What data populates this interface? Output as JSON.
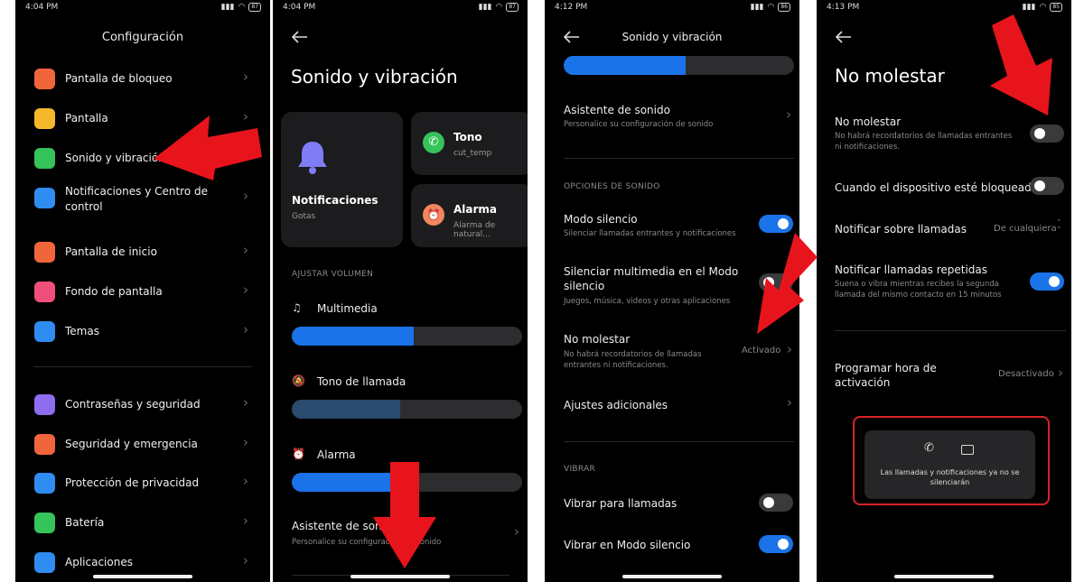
{
  "colors": {
    "accent": "#1a73e8",
    "arrow": "#e8141c",
    "highlight": "#d9232b"
  },
  "panel1": {
    "status": {
      "time": "4:04 PM",
      "battery": "87"
    },
    "title": "Configuración",
    "items": [
      {
        "label": "Pantalla de bloqueo",
        "icon": "lock-icon",
        "color": "#f0663a"
      },
      {
        "label": "Pantalla",
        "icon": "sun-icon",
        "color": "#f5b82a"
      },
      {
        "label": "Sonido y vibración",
        "icon": "speaker-icon",
        "color": "#35c35a"
      },
      {
        "label": "Notificaciones y Centro de control",
        "icon": "notification-icon",
        "color": "#2f8cf0"
      },
      {
        "label": "Pantalla de inicio",
        "icon": "home-icon",
        "color": "#f0663a"
      },
      {
        "label": "Fondo de pantalla",
        "icon": "flower-icon",
        "color": "#ef4f7a"
      },
      {
        "label": "Temas",
        "icon": "brush-icon",
        "color": "#2f8cf0"
      },
      {
        "label": "Contraseñas y seguridad",
        "icon": "fingerprint-icon",
        "color": "#8e6cf0"
      },
      {
        "label": "Seguridad y emergencia",
        "icon": "emergency-icon",
        "color": "#f0663a"
      },
      {
        "label": "Protección de privacidad",
        "icon": "privacy-icon",
        "color": "#2f8cf0"
      },
      {
        "label": "Batería",
        "icon": "battery-icon",
        "color": "#35c35a"
      },
      {
        "label": "Aplicaciones",
        "icon": "gear-icon",
        "color": "#2f8cf0"
      }
    ]
  },
  "panel2": {
    "status": {
      "time": "4:04 PM",
      "battery": "87"
    },
    "title": "Sonido y vibración",
    "cards": {
      "notifications": {
        "title": "Notificaciones",
        "sub": "Gotas"
      },
      "ringtone": {
        "title": "Tono",
        "sub": "cut_temp"
      },
      "alarm": {
        "title": "Alarma",
        "sub": "Alarma de natural..."
      }
    },
    "section_volume": "AJUSTAR VOLUMEN",
    "volumes": [
      {
        "label": "Multimedia",
        "icon": "music-note-icon",
        "level": 0.53,
        "color": "#1a73e8"
      },
      {
        "label": "Tono de llamada",
        "icon": "bell-off-icon",
        "level": 0.47,
        "color": "#2a4a6e"
      },
      {
        "label": "Alarma",
        "icon": "alarm-clock-icon",
        "level": 0.52,
        "color": "#1a73e8"
      }
    ],
    "assistant": {
      "title": "Asistente de sonido",
      "sub": "Personalice su configuración de sonido"
    }
  },
  "panel3": {
    "status": {
      "time": "4:12 PM",
      "battery": "86"
    },
    "title": "Sonido y vibración",
    "top_level": 0.53,
    "assistant": {
      "title": "Asistente de sonido",
      "sub": "Personalice su configuración de sonido"
    },
    "section_sound": "OPCIONES DE SONIDO",
    "silent_mode": {
      "title": "Modo silencio",
      "sub": "Silenciar llamadas entrantes y notificaciones",
      "on": true
    },
    "mute_media": {
      "title": "Silenciar multimedia en el Modo silencio",
      "sub": "Juegos, música, videos y otras aplicaciones"
    },
    "dnd": {
      "title": "No molestar",
      "sub": "No habrá recordatorios de llamadas entrantes ni notificaciones.",
      "value": "Activado"
    },
    "additional": {
      "title": "Ajustes adicionales"
    },
    "section_vibrate": "VIBRAR",
    "vibrate_calls": {
      "title": "Vibrar para llamadas",
      "on": false
    },
    "vibrate_silent": {
      "title": "Vibrar en Modo silencio",
      "on": true
    }
  },
  "panel4": {
    "status": {
      "time": "4:13 PM",
      "battery": "85"
    },
    "title": "No molestar",
    "dnd": {
      "title": "No molestar",
      "sub": "No habrá recordatorios de llamadas entrantes ni notificaciones.",
      "on": false
    },
    "locked": {
      "title": "Cuando el dispositivo esté bloqueado",
      "on": false
    },
    "notify_calls": {
      "title": "Notificar sobre llamadas",
      "value": "De cualquiera"
    },
    "repeat_calls": {
      "title": "Notificar llamadas repetidas",
      "sub": "Suena o vibra mientras recibes la segunda llamada del mismo contacto en 15 minutos",
      "on": true
    },
    "schedule": {
      "title": "Programar hora de activación",
      "value": "Desactivado"
    },
    "toast": {
      "text": "Las llamadas y notificaciones ya no se silenciarán"
    }
  }
}
